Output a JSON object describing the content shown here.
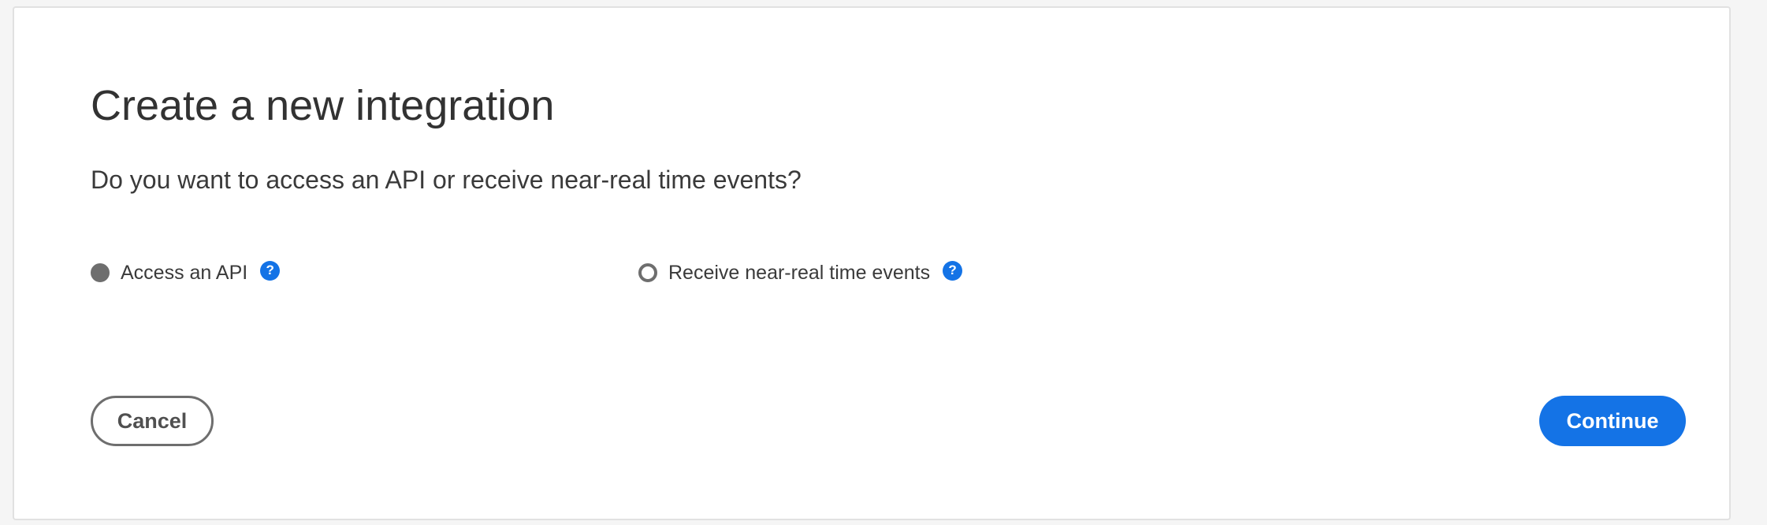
{
  "dialog": {
    "title": "Create a new integration",
    "question": "Do you want to access an API or receive near-real time events?",
    "options": [
      {
        "label": "Access an API",
        "selected": true,
        "help_icon": "question-mark-icon"
      },
      {
        "label": "Receive near-real time events",
        "selected": false,
        "help_icon": "question-mark-icon"
      }
    ],
    "help_glyph": "?",
    "cancel_label": "Cancel",
    "continue_label": "Continue"
  },
  "colors": {
    "accent": "#1473e6",
    "radio": "#6e6e6e",
    "text": "#3a3a3a",
    "background": "#f5f5f5",
    "card": "#ffffff"
  }
}
